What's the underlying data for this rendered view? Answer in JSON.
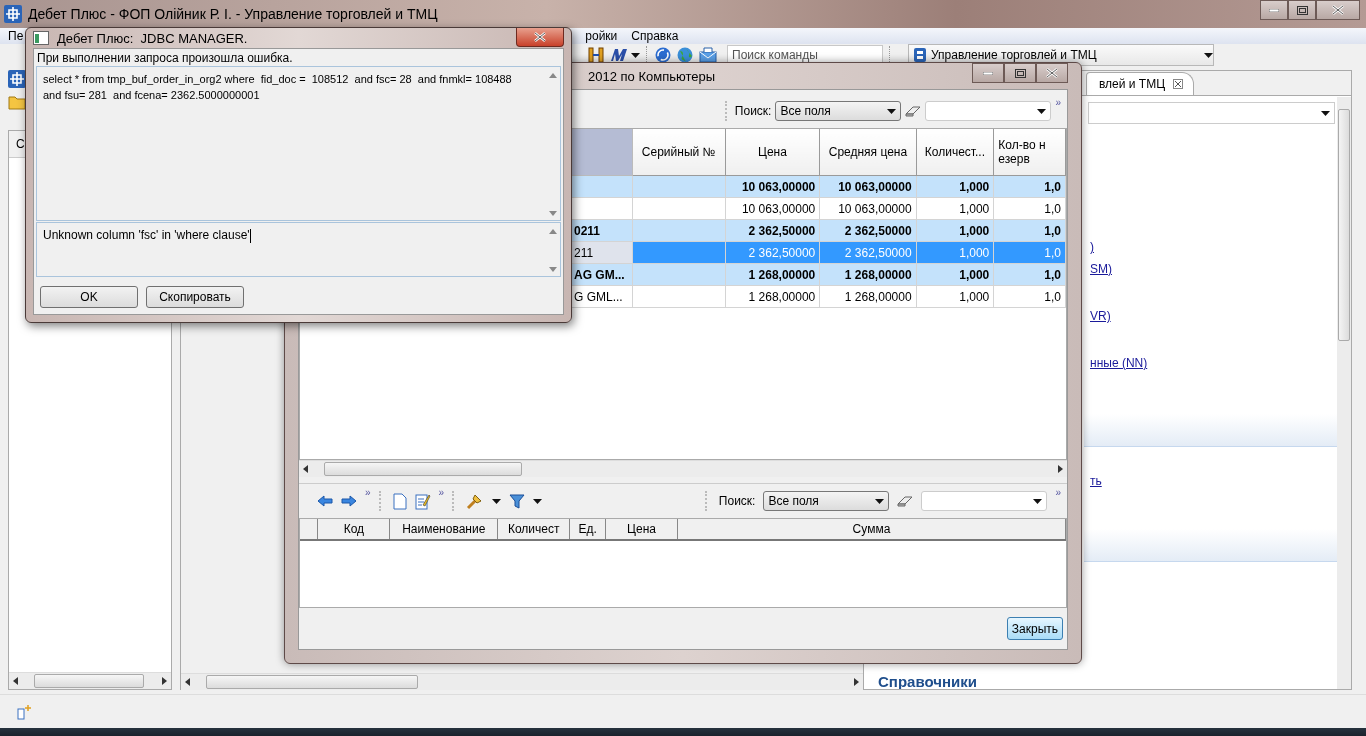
{
  "app_window": {
    "title": "Дебет Плюс - ФОП Олійник Р. І. - Управление торговлей и ТМЦ",
    "menu": [
      {
        "label": "Пе"
      },
      {
        "label": "ройки"
      },
      {
        "label": "Справка"
      }
    ],
    "command_search": {
      "placeholder": "Поиск команды"
    },
    "perspective": {
      "value": "Управление торговлей и ТМЦ"
    }
  },
  "left_panel": {
    "tab_label": "С"
  },
  "right_panel": {
    "tab": {
      "label": "влей и ТМЦ"
    },
    "links": [
      ")",
      "SM)",
      "VR)",
      "нные (NN)",
      "ть"
    ],
    "section_heading": "Справочники"
  },
  "document_window": {
    "title": "2012 по Компьютеры",
    "search": {
      "label": "Поиск:",
      "field": "Все поля",
      "more": "»"
    },
    "table": {
      "columns": [
        "Серийный №",
        "Цена",
        "Средняя цена",
        "Количест...",
        "Кол-во н\nезерв"
      ],
      "rows": [
        {
          "kind": "group",
          "selected": false,
          "price": "10 063,00000",
          "avg_price": "10 063,00000",
          "quantity": "1,000",
          "column_6": "1,0"
        },
        {
          "kind": "item",
          "selected": false,
          "price": "10 063,00000",
          "avg_price": "10 063,00000",
          "quantity": "1,000",
          "column_6": "1,0"
        },
        {
          "kind": "group",
          "selected": false,
          "name": "0211",
          "price": "2 362,50000",
          "avg_price": "2 362,50000",
          "quantity": "1,000",
          "column_6": "1,0"
        },
        {
          "kind": "item",
          "selected": true,
          "name": "211",
          "price": "2 362,50000",
          "avg_price": "2 362,50000",
          "quantity": "1,000",
          "column_6": "1,0"
        },
        {
          "kind": "group",
          "selected": false,
          "name": "AG GM...",
          "price": "1 268,00000",
          "avg_price": "1 268,00000",
          "quantity": "1,000",
          "column_6": "1,0"
        },
        {
          "kind": "item",
          "selected": false,
          "name": "G GML...",
          "price": "1 268,00000",
          "avg_price": "1 268,00000",
          "quantity": "1,000",
          "column_6": "1,0"
        }
      ]
    },
    "lines_toolbar": {
      "more": [
        "»",
        "»"
      ]
    },
    "lines_search": {
      "label": "Поиск:",
      "field": "Все поля",
      "more": "»"
    },
    "lines_table": {
      "columns": [
        "Код",
        "Наименование",
        "Количест",
        "Ед.",
        "Цена",
        "Сумма"
      ]
    },
    "close_button": "Закрыть"
  },
  "dialog": {
    "title": "Дебет Плюс:  JDBC MANAGER.",
    "message": "При выполнении запроса произошла ошибка.",
    "query": "select * from tmp_buf_order_in_org2 where  fid_doc =  108512  and fsc= 28  and fnmkl= 108488\nand fsu= 281  and fcena= 2362.5000000001",
    "error": "Unknown column 'fsc' in 'where clause'",
    "buttons": [
      "OK",
      "Скопировать"
    ]
  }
}
